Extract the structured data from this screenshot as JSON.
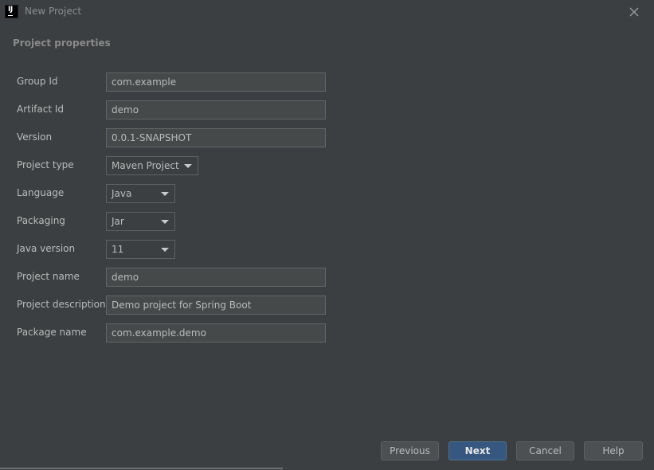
{
  "window": {
    "title": "New Project",
    "app_icon": "intellij-logo-icon",
    "app_icon_text": "IJ"
  },
  "section": {
    "title": "Project properties"
  },
  "fields": {
    "group_id": {
      "label": "Group Id",
      "value": "com.example"
    },
    "artifact_id": {
      "label": "Artifact Id",
      "value": "demo"
    },
    "version": {
      "label": "Version",
      "value": "0.0.1-SNAPSHOT"
    },
    "project_type": {
      "label": "Project type",
      "value": "Maven Project"
    },
    "language": {
      "label": "Language",
      "value": "Java"
    },
    "packaging": {
      "label": "Packaging",
      "value": "Jar"
    },
    "java_version": {
      "label": "Java version",
      "value": "11"
    },
    "project_name": {
      "label": "Project name",
      "value": "demo"
    },
    "project_description": {
      "label": "Project description",
      "value": "Demo project for Spring Boot"
    },
    "package_name": {
      "label": "Package name",
      "value": "com.example.demo"
    }
  },
  "buttons": {
    "previous": "Previous",
    "next": "Next",
    "cancel": "Cancel",
    "help": "Help"
  },
  "colors": {
    "background": "#3c3f41",
    "input_background": "#45494a",
    "primary_button": "#365880",
    "text": "#bbbbbb"
  }
}
